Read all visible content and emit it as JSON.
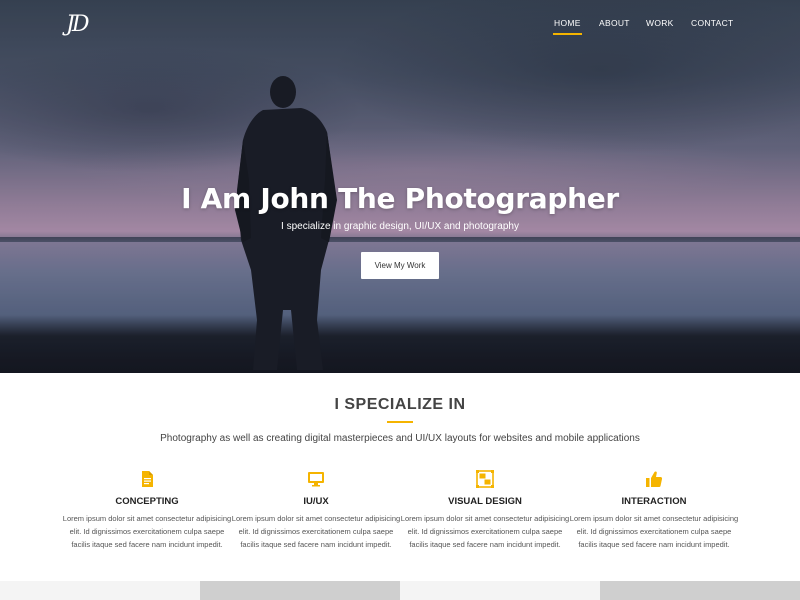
{
  "header": {
    "logo_text": "JD",
    "nav": [
      {
        "label": "HOME",
        "active": true
      },
      {
        "label": "ABOUT",
        "active": false
      },
      {
        "label": "WORK",
        "active": false
      },
      {
        "label": "CONTACT",
        "active": false
      }
    ]
  },
  "hero": {
    "title": "I Am John The Photographer",
    "subtitle": "I specialize in graphic design, UI/UX and photography",
    "button_label": "View My Work"
  },
  "specialize": {
    "title": "I SPECIALIZE IN",
    "description": "Photography as well as creating digital masterpieces and UI/UX layouts for websites and mobile applications",
    "features": [
      {
        "icon": "document-icon",
        "title": "CONCEPTING",
        "desc": "Lorem ipsum dolor sit amet consectetur adipisicing elit. Id dignissimos exercitationem culpa saepe facilis itaque sed facere nam incidunt impedit."
      },
      {
        "icon": "monitor-icon",
        "title": "IU/UX",
        "desc": "Lorem ipsum dolor sit amet consectetur adipisicing elit. Id dignissimos exercitationem culpa saepe facilis itaque sed facere nam incidunt impedit."
      },
      {
        "icon": "object-group-icon",
        "title": "VISUAL DESIGN",
        "desc": "Lorem ipsum dolor sit amet consectetur adipisicing elit. Id dignissimos exercitationem culpa saepe facilis itaque sed facere nam incidunt impedit."
      },
      {
        "icon": "thumbs-up-icon",
        "title": "INTERACTION",
        "desc": "Lorem ipsum dolor sit amet consectetur adipisicing elit. Id dignissimos exercitationem culpa saepe facilis itaque sed facere nam incidunt impedit."
      }
    ]
  },
  "colors": {
    "accent": "#f5b400",
    "strip": [
      "#f4f4f4",
      "#cfcfcf",
      "#f4f4f4",
      "#cfcfcf"
    ]
  }
}
